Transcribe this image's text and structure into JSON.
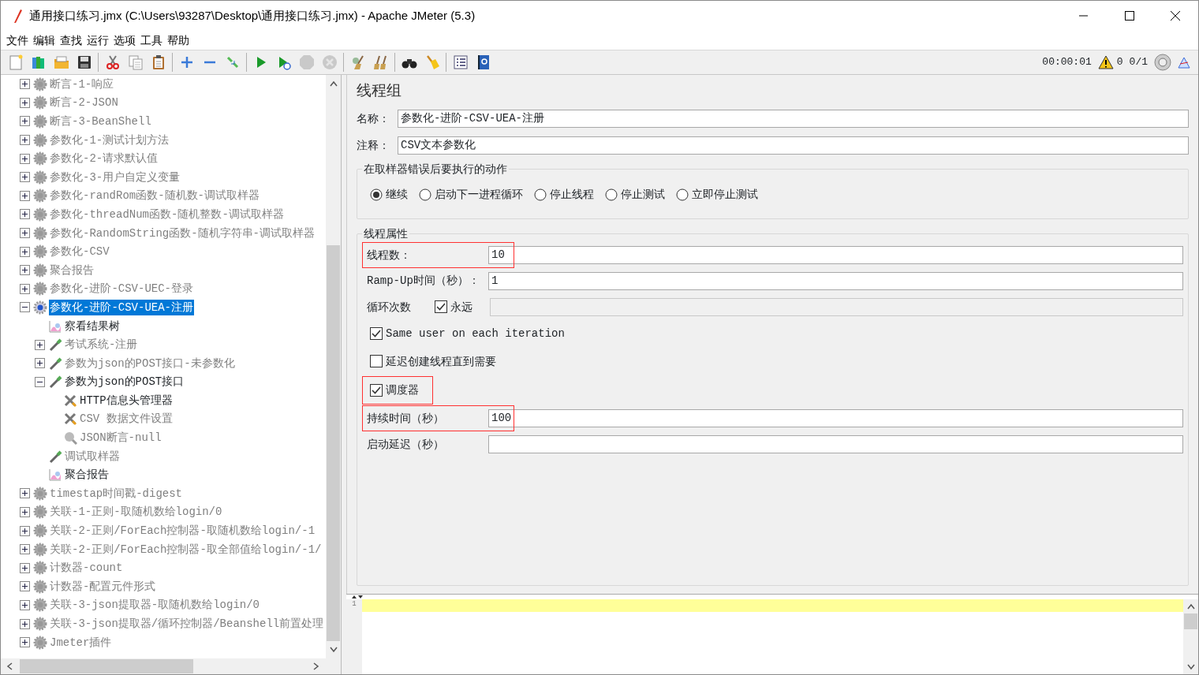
{
  "window": {
    "title": "通用接口练习.jmx (C:\\Users\\93287\\Desktop\\通用接口练习.jmx) - Apache JMeter (5.3)"
  },
  "menu": [
    "文件",
    "编辑",
    "查找",
    "运行",
    "选项",
    "工具",
    "帮助"
  ],
  "toolbar": [
    [
      {
        "kind": "new",
        "disabled": false
      },
      {
        "kind": "templates",
        "disabled": false
      },
      {
        "kind": "open",
        "disabled": false
      },
      {
        "kind": "save",
        "disabled": false
      }
    ],
    [
      {
        "kind": "cut",
        "disabled": false
      },
      {
        "kind": "copy",
        "disabled": false
      },
      {
        "kind": "paste",
        "disabled": false
      }
    ],
    [
      {
        "kind": "expand",
        "disabled": false
      },
      {
        "kind": "collapse",
        "disabled": false
      },
      {
        "kind": "toggle",
        "disabled": false
      }
    ],
    [
      {
        "kind": "start",
        "disabled": false
      },
      {
        "kind": "start-no-pause",
        "disabled": false
      },
      {
        "kind": "stop",
        "disabled": true
      },
      {
        "kind": "shutdown",
        "disabled": true
      }
    ],
    [
      {
        "kind": "clear",
        "disabled": false
      },
      {
        "kind": "clear-all",
        "disabled": false
      }
    ],
    [
      {
        "kind": "search",
        "disabled": false
      },
      {
        "kind": "reset-search",
        "disabled": false
      }
    ],
    [
      {
        "kind": "function-helper",
        "disabled": false
      },
      {
        "kind": "help",
        "disabled": false
      }
    ]
  ],
  "status": {
    "timer": "00:00:01",
    "warnings": "0",
    "threads": "0/1"
  },
  "tree": [
    {
      "label": "断言-1-响应",
      "kind": "thread-group",
      "enabled": false,
      "selected": false,
      "expanded": false
    },
    {
      "label": "断言-2-JSON",
      "kind": "thread-group",
      "enabled": false,
      "selected": false,
      "expanded": false
    },
    {
      "label": "断言-3-BeanShell",
      "kind": "thread-group",
      "enabled": false,
      "selected": false,
      "expanded": false
    },
    {
      "label": "参数化-1-测试计划方法",
      "kind": "thread-group",
      "enabled": false,
      "selected": false,
      "expanded": false
    },
    {
      "label": "参数化-2-请求默认值",
      "kind": "thread-group",
      "enabled": false,
      "selected": false,
      "expanded": false
    },
    {
      "label": "参数化-3-用户自定义变量",
      "kind": "thread-group",
      "enabled": false,
      "selected": false,
      "expanded": false
    },
    {
      "label": "参数化-randRom函数-随机数-调试取样器",
      "kind": "thread-group",
      "enabled": false,
      "selected": false,
      "expanded": false
    },
    {
      "label": "参数化-threadNum函数-随机整数-调试取样器",
      "kind": "thread-group",
      "enabled": false,
      "selected": false,
      "expanded": false
    },
    {
      "label": "参数化-RandomString函数-随机字符串-调试取样器",
      "kind": "thread-group",
      "enabled": false,
      "selected": false,
      "expanded": false
    },
    {
      "label": "参数化-CSV",
      "kind": "thread-group",
      "enabled": false,
      "selected": false,
      "expanded": false
    },
    {
      "label": "聚合报告",
      "kind": "thread-group",
      "enabled": false,
      "selected": false,
      "expanded": false
    },
    {
      "label": "参数化-进阶-CSV-UEC-登录",
      "kind": "thread-group",
      "enabled": false,
      "selected": false,
      "expanded": false
    },
    {
      "label": "参数化-进阶-CSV-UEA-注册",
      "kind": "thread-group",
      "enabled": true,
      "selected": true,
      "expanded": true,
      "children": [
        {
          "label": "察看结果树",
          "kind": "listener",
          "enabled": true,
          "selected": false
        },
        {
          "label": "考试系统-注册",
          "kind": "sampler",
          "enabled": false,
          "selected": false,
          "expanded": false
        },
        {
          "label": "参数为json的POST接口-未参数化",
          "kind": "sampler",
          "enabled": false,
          "selected": false,
          "expanded": false
        },
        {
          "label": "参数为json的POST接口",
          "kind": "sampler",
          "enabled": true,
          "selected": false,
          "expanded": true,
          "children": [
            {
              "label": "HTTP信息头管理器",
              "kind": "config",
              "enabled": true,
              "selected": false
            },
            {
              "label": "CSV 数据文件设置",
              "kind": "config",
              "enabled": false,
              "selected": false
            },
            {
              "label": "JSON断言-null",
              "kind": "assertion",
              "enabled": false,
              "selected": false
            }
          ]
        },
        {
          "label": "调试取样器",
          "kind": "sampler",
          "enabled": false,
          "selected": false
        },
        {
          "label": "聚合报告",
          "kind": "listener",
          "enabled": true,
          "selected": false
        }
      ]
    },
    {
      "label": "timestap时间戳-digest",
      "kind": "thread-group",
      "enabled": false,
      "selected": false,
      "expanded": false
    },
    {
      "label": "关联-1-正则-取随机数给login/0",
      "kind": "thread-group",
      "enabled": false,
      "selected": false,
      "expanded": false
    },
    {
      "label": "关联-2-正则/ForEach控制器-取随机数给login/-1",
      "kind": "thread-group",
      "enabled": false,
      "selected": false,
      "expanded": false
    },
    {
      "label": "关联-2-正则/ForEach控制器-取全部值给login/-1/",
      "kind": "thread-group",
      "enabled": false,
      "selected": false,
      "expanded": false
    },
    {
      "label": "计数器-count",
      "kind": "thread-group",
      "enabled": false,
      "selected": false,
      "expanded": false
    },
    {
      "label": "计数器-配置元件形式",
      "kind": "thread-group",
      "enabled": false,
      "selected": false,
      "expanded": false
    },
    {
      "label": "关联-3-json提取器-取随机数给login/0",
      "kind": "thread-group",
      "enabled": false,
      "selected": false,
      "expanded": false
    },
    {
      "label": "关联-3-json提取器/循环控制器/Beanshell前置处理",
      "kind": "thread-group",
      "enabled": false,
      "selected": false,
      "expanded": false
    },
    {
      "label": "Jmeter插件",
      "kind": "thread-group",
      "enabled": false,
      "selected": false,
      "expanded": false
    }
  ],
  "panel": {
    "title": "线程组",
    "name": {
      "label": "名称：",
      "value": "参数化-进阶-CSV-UEA-注册"
    },
    "comment": {
      "label": "注释：",
      "value": "CSV文本参数化"
    },
    "on_error": {
      "title": "在取样器错误后要执行的动作",
      "options": [
        {
          "label": "继续",
          "selected": true
        },
        {
          "label": "启动下一进程循环",
          "selected": false
        },
        {
          "label": "停止线程",
          "selected": false
        },
        {
          "label": "停止测试",
          "selected": false
        },
        {
          "label": "立即停止测试",
          "selected": false
        }
      ]
    },
    "thread_properties": {
      "title": "线程属性",
      "rows": [
        {
          "kind": "field",
          "label": "线程数：",
          "value": "10",
          "highlighted": true
        },
        {
          "kind": "field",
          "label": "Ramp-Up时间（秒）：",
          "value": "1",
          "highlighted": false
        },
        {
          "kind": "loop",
          "label": "循环次数",
          "option": "永远",
          "checked": true
        },
        {
          "kind": "checkbox",
          "label": "Same user on each iteration",
          "checked": true,
          "highlighted": false
        },
        {
          "kind": "checkbox",
          "label": "延迟创建线程直到需要",
          "checked": false,
          "highlighted": false
        },
        {
          "kind": "checkbox",
          "label": "调度器",
          "checked": true,
          "highlighted": true
        },
        {
          "kind": "field",
          "label": "持续时间（秒）",
          "value": "100",
          "highlighted": true
        },
        {
          "kind": "field",
          "label": "启动延迟（秒）",
          "value": "",
          "highlighted": false
        }
      ]
    }
  },
  "log": {
    "lines": [
      "1"
    ]
  }
}
